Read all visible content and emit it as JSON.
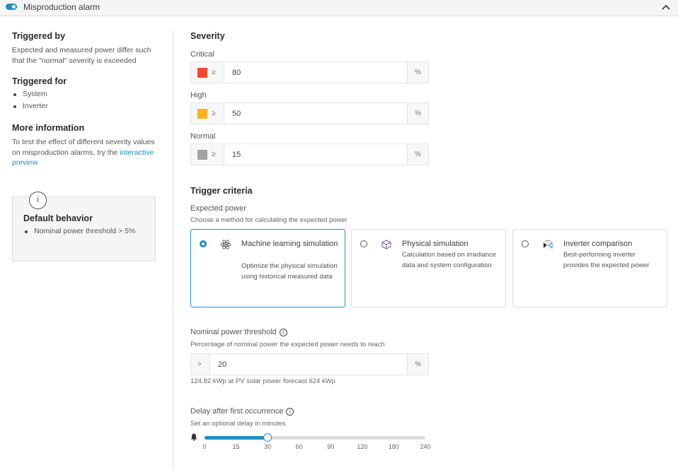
{
  "header": {
    "title": "Misproduction alarm",
    "toggle_on": true,
    "accent_color": "#1d8fc7"
  },
  "sidebar": {
    "triggered_by": {
      "heading": "Triggered by",
      "text": "Expected and measured power differ such that the \"normal\" severity is exceeded"
    },
    "triggered_for": {
      "heading": "Triggered for",
      "items": [
        "System",
        "Inverter"
      ]
    },
    "more_info": {
      "heading": "More information",
      "text": "To test the effect of different severity values on misproduction alarms, try the ",
      "link": "interactive preview"
    },
    "default_behavior": {
      "icon": "i",
      "heading": "Default behavior",
      "items": [
        "Nominal power threshold > 5%"
      ]
    }
  },
  "severity": {
    "heading": "Severity",
    "levels": [
      {
        "label": "Critical",
        "color": "#ef4a2b",
        "operator": "≥",
        "value": "80",
        "unit": "%"
      },
      {
        "label": "High",
        "color": "#fbb120",
        "operator": "≥",
        "value": "50",
        "unit": "%"
      },
      {
        "label": "Normal",
        "color": "#a3a3a3",
        "operator": "≥",
        "value": "15",
        "unit": "%"
      }
    ]
  },
  "trigger_criteria": {
    "heading": "Trigger criteria",
    "expected_power": {
      "label": "Expected power",
      "description": "Choose a method for calculating the expected power",
      "options": [
        {
          "title": "Machine learning simulation",
          "description": "Optimize the physical simulation using historical measured data",
          "icon": "atom-icon",
          "selected": true
        },
        {
          "title": "Physical simulation",
          "description": "Calculation based on irradiance data and system configuration",
          "icon": "cube-icon",
          "selected": false
        },
        {
          "title": "Inverter comparison",
          "description": "Best-performing inverter provides the expected power",
          "icon": "inverter-icon",
          "selected": false
        }
      ]
    },
    "nominal_threshold": {
      "label": "Nominal power threshold",
      "description": "Percentage of nominal power the expected power needs to reach",
      "operator": ">",
      "value": "20",
      "unit": "%",
      "hint": "124.82 kWp at PV solar power forecast 624 kWp"
    },
    "delay": {
      "label": "Delay after first occurrence",
      "description": "Set an optional delay in minutes",
      "ticks": [
        "0",
        "15",
        "30",
        "60",
        "90",
        "120",
        "180",
        "240"
      ],
      "selected_value": "30",
      "selected_index": 2
    }
  }
}
